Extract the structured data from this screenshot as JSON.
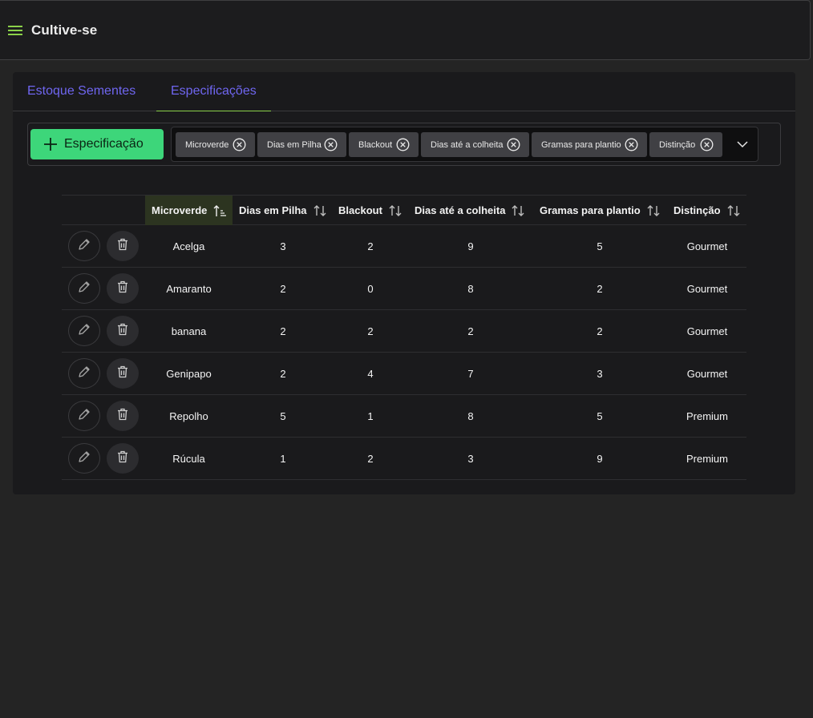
{
  "app": {
    "title": "Cultive-se",
    "accent": "#8bd14a",
    "tab_color": "#6f66f0",
    "add_button_color": "#3dd67a"
  },
  "tabs": [
    {
      "label": "Estoque Sementes",
      "active": false
    },
    {
      "label": "Especificações",
      "active": true
    }
  ],
  "toolbar": {
    "add_label": "Especificação",
    "chips": [
      {
        "label": "Microverde"
      },
      {
        "label": "Dias em Pilha"
      },
      {
        "label": "Blackout"
      },
      {
        "label": "Dias até a colheita"
      },
      {
        "label": "Gramas para plantio"
      },
      {
        "label": "Distinção"
      }
    ]
  },
  "table": {
    "columns": [
      {
        "label": "Microverde",
        "sorted": "asc"
      },
      {
        "label": "Dias em Pilha"
      },
      {
        "label": "Blackout"
      },
      {
        "label": "Dias até a colheita"
      },
      {
        "label": "Gramas para plantio"
      },
      {
        "label": "Distinção"
      }
    ],
    "rows": [
      {
        "microverde": "Acelga",
        "dias_pilha": "3",
        "blackout": "2",
        "dias_colheita": "9",
        "gramas": "5",
        "distincao": "Gourmet"
      },
      {
        "microverde": "Amaranto",
        "dias_pilha": "2",
        "blackout": "0",
        "dias_colheita": "8",
        "gramas": "2",
        "distincao": "Gourmet"
      },
      {
        "microverde": "banana",
        "dias_pilha": "2",
        "blackout": "2",
        "dias_colheita": "2",
        "gramas": "2",
        "distincao": "Gourmet"
      },
      {
        "microverde": "Genipapo",
        "dias_pilha": "2",
        "blackout": "4",
        "dias_colheita": "7",
        "gramas": "3",
        "distincao": "Gourmet"
      },
      {
        "microverde": "Repolho",
        "dias_pilha": "5",
        "blackout": "1",
        "dias_colheita": "8",
        "gramas": "5",
        "distincao": "Premium"
      },
      {
        "microverde": "Rúcula",
        "dias_pilha": "1",
        "blackout": "2",
        "dias_colheita": "3",
        "gramas": "9",
        "distincao": "Premium"
      }
    ]
  }
}
